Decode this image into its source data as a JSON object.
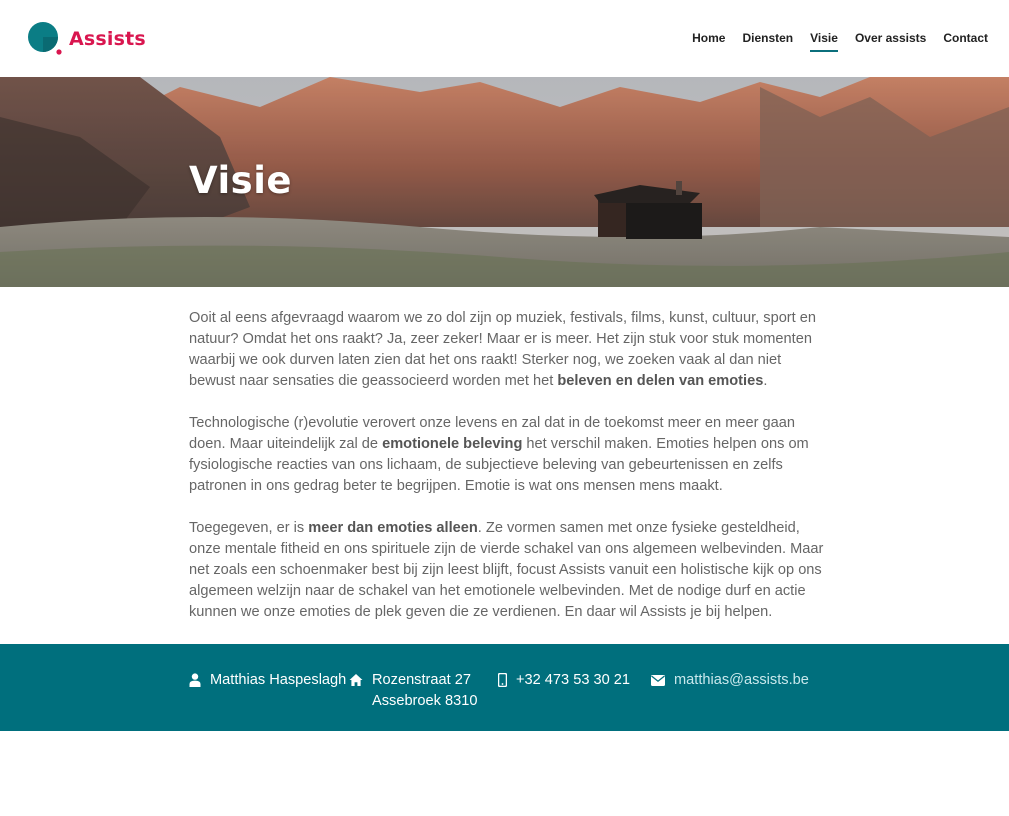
{
  "brand": {
    "name": "Assists",
    "accent": "#d9164f",
    "teal": "#0b6f7c"
  },
  "nav": {
    "items": [
      {
        "label": "Home",
        "active": false
      },
      {
        "label": "Diensten",
        "active": false
      },
      {
        "label": "Visie",
        "active": true
      },
      {
        "label": "Over assists",
        "active": false
      },
      {
        "label": "Contact",
        "active": false
      }
    ]
  },
  "hero": {
    "title": "Visie"
  },
  "content": {
    "p1": {
      "text": "Ooit al eens afgevraagd waarom we zo dol zijn op muziek, festivals, films, kunst, cultuur, sport en natuur? Omdat het ons raakt? Ja, zeer zeker! Maar er is meer. Het zijn stuk voor stuk momenten waarbij we ook durven laten zien dat het ons raakt! Sterker nog, we zoeken vaak al dan niet bewust naar sensaties die geassocieerd worden met het ",
      "bold": "beleven en delen van emoties",
      "after": "."
    },
    "p2": {
      "before": "Technologische (r)evolutie verovert onze levens en zal dat in de toekomst meer en meer gaan doen. Maar uiteindelijk zal de ",
      "bold": "emotionele beleving",
      "after": " het verschil maken. Emoties helpen ons om fysiologische reacties van ons lichaam, de subjectieve beleving van gebeurtenissen en zelfs patronen in ons gedrag beter te begrijpen. Emotie is wat ons mensen mens maakt."
    },
    "p3": {
      "before": "Toegegeven, er is ",
      "bold": "meer dan emoties alleen",
      "after": ". Ze vormen samen met onze fysieke gesteldheid, onze mentale fitheid en ons spirituele zijn de vierde schakel van ons algemeen welbevinden. Maar net zoals een schoenmaker best bij zijn leest blijft, focust Assists vanuit een holistische kijk op ons algemeen welzijn naar de schakel van het emotionele welbevinden. Met de nodige durf en actie kunnen we onze emoties de plek geven die ze verdienen. En daar wil Assists je bij helpen."
    }
  },
  "footer": {
    "background": "#006f7d",
    "name": "Matthias Haspeslagh",
    "address_line1": "Rozenstraat 27",
    "address_line2": "Assebroek 8310",
    "phone": "+32 473 53 30 21",
    "email": "matthias@assists.be",
    "icons": [
      "user-icon",
      "home-icon",
      "mobile-phone-icon",
      "envelope-icon"
    ]
  }
}
